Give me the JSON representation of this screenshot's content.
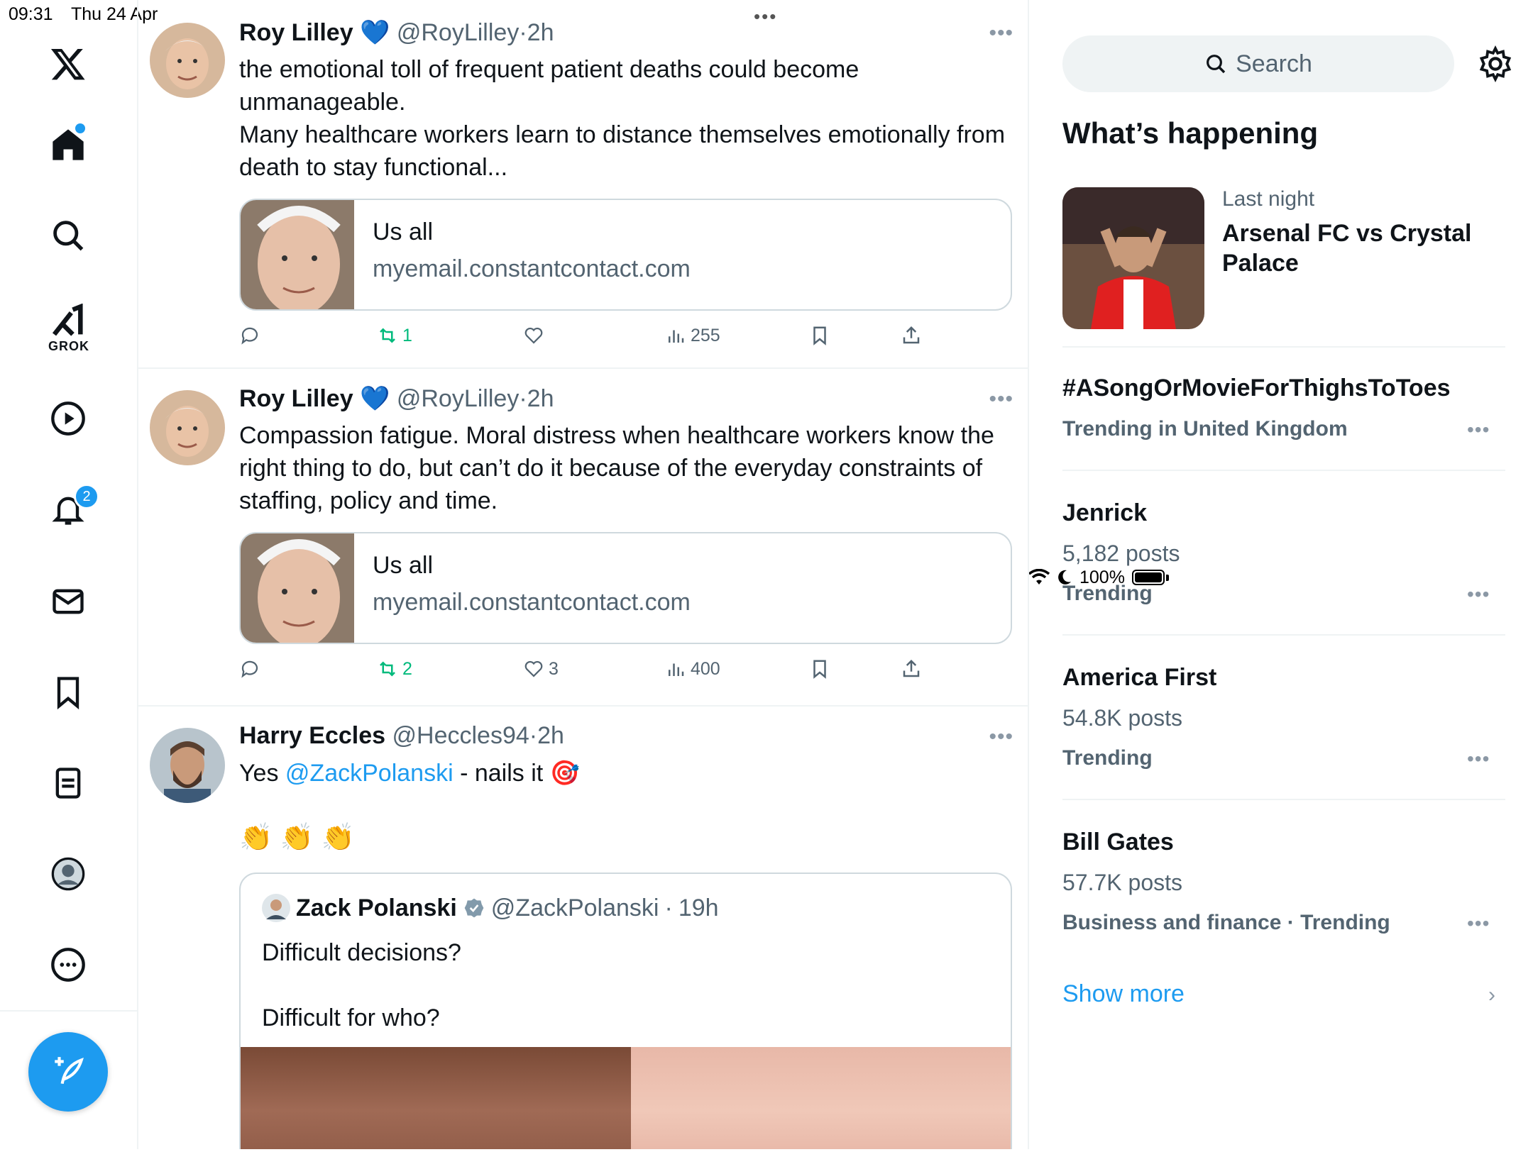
{
  "status": {
    "time": "09:31",
    "date": "Thu 24 Apr",
    "battery": "100%"
  },
  "nav": {
    "grok_label": "GROK",
    "notifications_badge": "2"
  },
  "tweets": [
    {
      "name": "Roy Lilley",
      "heart": "💙",
      "handle": "@RoyLilley",
      "time": "2h",
      "text": "the emotional toll of frequent patient deaths could become unmanageable.\nMany healthcare workers learn to distance themselves emotionally from death to stay functional...",
      "card": {
        "title": "Us all",
        "url": "myemail.constantcontact.com"
      },
      "retweets": "1",
      "likes": "",
      "views": "255"
    },
    {
      "name": "Roy Lilley",
      "heart": "💙",
      "handle": "@RoyLilley",
      "time": "2h",
      "text": "Compassion fatigue. Moral distress when healthcare workers know the right thing to do, but can’t do it because of the everyday constraints of staffing, policy and time.",
      "card": {
        "title": "Us all",
        "url": "myemail.constantcontact.com"
      },
      "retweets": "2",
      "likes": "3",
      "views": "400"
    },
    {
      "name": "Harry Eccles",
      "handle": "@Heccles94",
      "time": "2h",
      "text_prefix": "Yes ",
      "mention": "@ZackPolanski",
      "text_suffix": " - nails it 🎯",
      "emoji_line": "👏 👏 👏",
      "quote": {
        "name": "Zack Polanski",
        "handle": "@ZackPolanski",
        "time": "19h",
        "line1": "Difficult decisions?",
        "line2": "Difficult for who?"
      }
    }
  ],
  "search": {
    "placeholder": "Search"
  },
  "whats_happening": {
    "title": "What’s happening",
    "event": {
      "meta": "Last night",
      "title": "Arsenal FC vs Crystal Palace"
    },
    "trends": [
      {
        "title": "#ASongOrMovieForThighsToToes",
        "sub": "Trending in United Kingdom"
      },
      {
        "title": "Jenrick",
        "posts": "5,182 posts",
        "sub": "Trending"
      },
      {
        "title": "America First",
        "posts": "54.8K posts",
        "sub": "Trending"
      },
      {
        "title": "Bill Gates",
        "posts": "57.7K posts",
        "sub": "Business and finance · Trending"
      }
    ],
    "show_more": "Show more"
  }
}
